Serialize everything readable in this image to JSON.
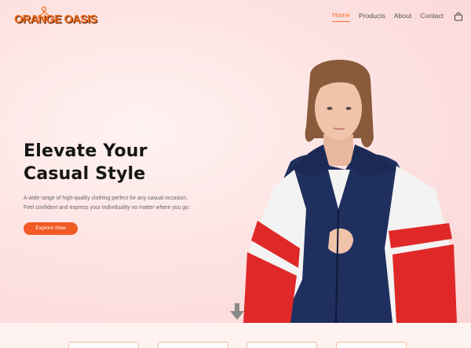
{
  "brand": {
    "name": "ORANGE OASIS",
    "logo_icon": "hanger-icon",
    "accent": "#f15a24"
  },
  "nav": {
    "items": [
      {
        "label": "Home",
        "active": true
      },
      {
        "label": "Products",
        "active": false
      },
      {
        "label": "About",
        "active": false
      },
      {
        "label": "Contact",
        "active": false
      }
    ],
    "cart_icon": "shopping-bag-icon"
  },
  "hero": {
    "headline_line1": "Elevate Your",
    "headline_line2": "Casual Style",
    "description_line1": "A wide range of high-quality clothing perfect for any casual occasion.",
    "description_line2": "Feel confident and express your individuality no matter where you go.",
    "cta_label": "Explore Now",
    "scroll_icon": "arrow-down-icon",
    "image": "woman-in-red-white-navy-windbreaker"
  },
  "feature_cards": [
    {
      "id": 1
    },
    {
      "id": 2
    },
    {
      "id": 3
    },
    {
      "id": 4
    }
  ]
}
